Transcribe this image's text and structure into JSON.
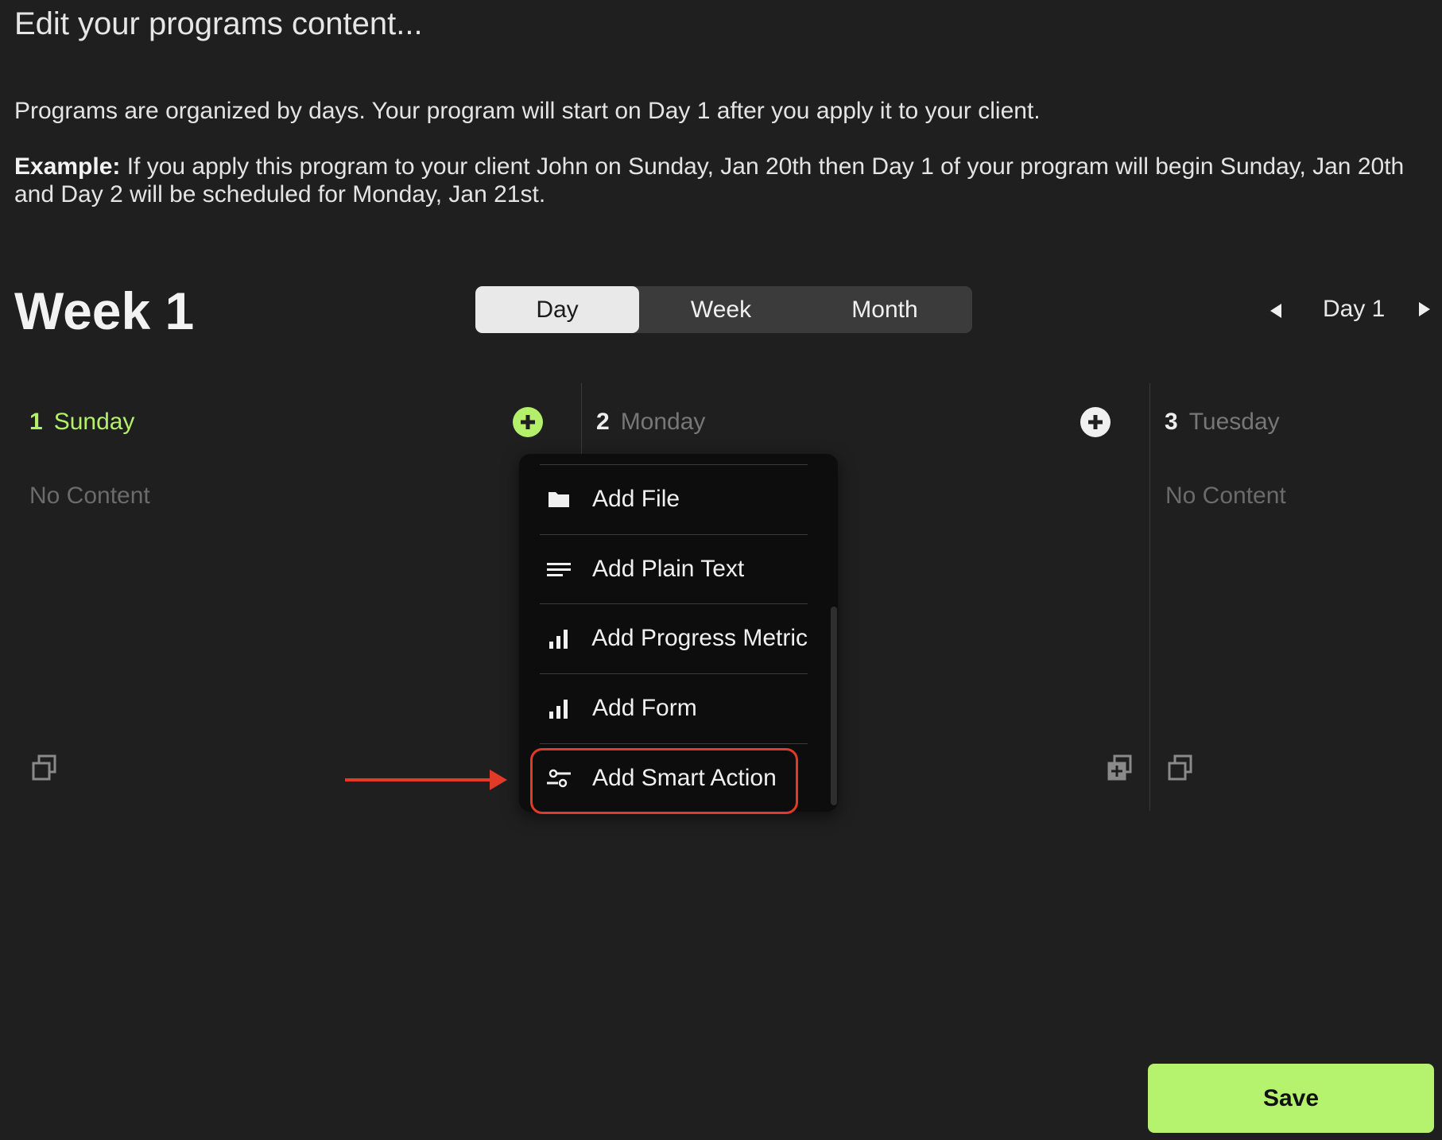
{
  "page": {
    "title": "Edit your programs content...",
    "intro_text": "Programs are organized by days. Your program will start on Day 1 after you apply it to your client.",
    "example_label": "Example:",
    "example_text": " If you apply this program to your client John on Sunday, Jan 20th then Day 1 of your program will begin Sunday, Jan 20th and Day 2 will be scheduled for Monday, Jan 21st."
  },
  "week": {
    "title": "Week 1"
  },
  "view_toggle": {
    "options": [
      "Day",
      "Week",
      "Month"
    ],
    "selected": "Day"
  },
  "day_nav": {
    "label": "Day 1"
  },
  "days": [
    {
      "number": "1",
      "name": "Sunday",
      "empty_text": "No Content",
      "active": true
    },
    {
      "number": "2",
      "name": "Monday",
      "empty_text": "",
      "active": false
    },
    {
      "number": "3",
      "name": "Tuesday",
      "empty_text": "No Content",
      "active": false
    }
  ],
  "dropdown": {
    "items": [
      {
        "label": "Add File",
        "icon": "folder-icon"
      },
      {
        "label": "Add Plain Text",
        "icon": "text-lines-icon"
      },
      {
        "label": "Add Progress Metric",
        "icon": "bar-chart-icon"
      },
      {
        "label": "Add Form",
        "icon": "bar-chart-icon"
      },
      {
        "label": "Add Smart Action",
        "icon": "sliders-icon"
      }
    ],
    "highlighted_item": "Add Smart Action"
  },
  "colors": {
    "accent_green": "#b3ef6a",
    "annotation_red": "#e13a26",
    "background": "#1f1f1f"
  },
  "footer": {
    "save_label": "Save"
  }
}
